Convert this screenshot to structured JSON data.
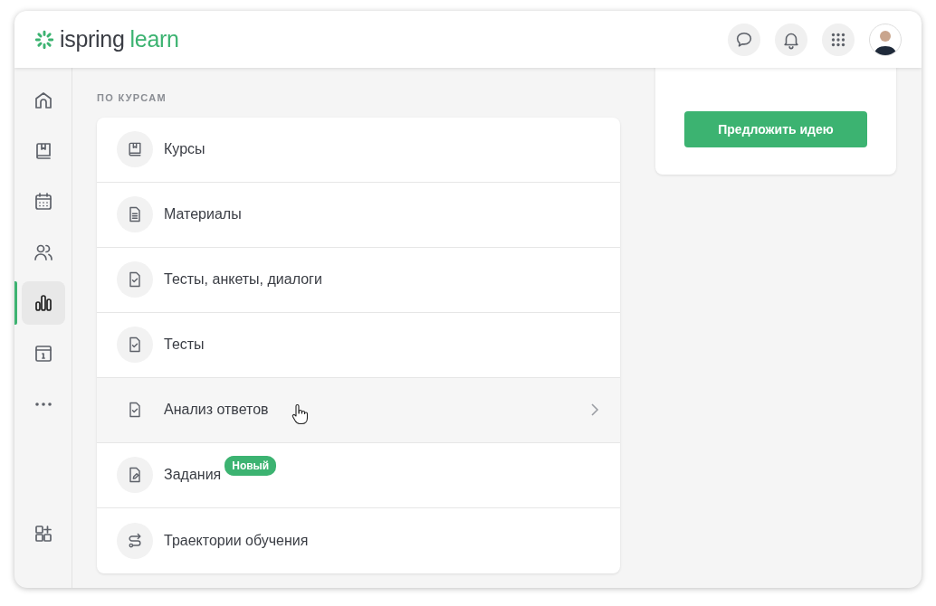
{
  "header": {
    "logo": {
      "brand": "ispring",
      "product": "learn"
    },
    "actions": [
      {
        "kind": "chat"
      },
      {
        "kind": "bell"
      },
      {
        "kind": "apps"
      }
    ]
  },
  "sidebar": {
    "items": [
      {
        "kind": "home",
        "selected": false
      },
      {
        "kind": "book",
        "selected": false
      },
      {
        "kind": "calendar",
        "selected": false
      },
      {
        "kind": "users",
        "selected": false
      },
      {
        "kind": "chart",
        "selected": true
      },
      {
        "kind": "info",
        "selected": false
      },
      {
        "kind": "more",
        "selected": false
      }
    ],
    "bottom": [
      {
        "kind": "add-widget",
        "selected": false
      }
    ]
  },
  "section": {
    "title": "ПО КУРСАМ",
    "items": [
      {
        "label": "Курсы",
        "kind": "book",
        "hovered": false
      },
      {
        "label": "Материалы",
        "kind": "document",
        "hovered": false
      },
      {
        "label": "Тесты, анкеты, диалоги",
        "kind": "check-doc",
        "hovered": false
      },
      {
        "label": "Тесты",
        "kind": "check-doc",
        "hovered": false
      },
      {
        "label": "Анализ ответов",
        "kind": "check-doc",
        "hovered": true
      },
      {
        "label": "Задания",
        "kind": "edit-doc",
        "hovered": false,
        "badge": "Новый"
      },
      {
        "label": "Траектории обучения",
        "kind": "route",
        "hovered": false
      }
    ]
  },
  "side_panel": {
    "button": "Предложить идею"
  }
}
